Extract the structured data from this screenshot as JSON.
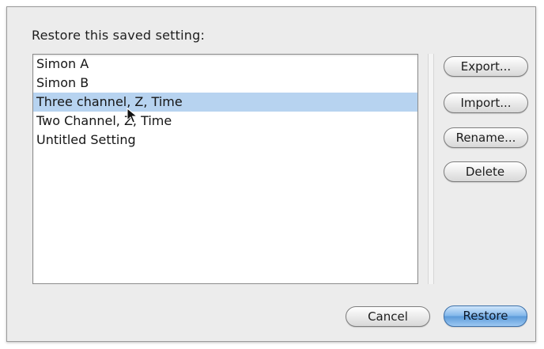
{
  "dialog": {
    "prompt": "Restore this saved setting:"
  },
  "settings_list": {
    "items": [
      {
        "label": "Simon A",
        "selected": false
      },
      {
        "label": "Simon B",
        "selected": false
      },
      {
        "label": "Three channel, Z, Time",
        "selected": true
      },
      {
        "label": "Two Channel, Z, Time",
        "selected": false
      },
      {
        "label": "Untitled Setting",
        "selected": false
      }
    ]
  },
  "side_buttons": {
    "export_label": "Export...",
    "import_label": "Import...",
    "rename_label": "Rename...",
    "delete_label": "Delete"
  },
  "footer": {
    "cancel_label": "Cancel",
    "restore_label": "Restore"
  },
  "colors": {
    "selection": "#b7d3f0",
    "default_button": "#5b9ad9",
    "dialog_background": "#ececec"
  },
  "icons": {
    "pointer": "arrow-cursor-icon"
  }
}
